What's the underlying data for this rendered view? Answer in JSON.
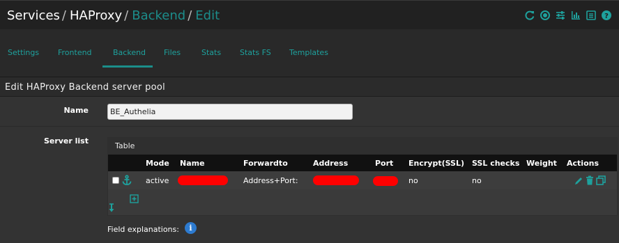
{
  "breadcrumb": {
    "items": [
      "Services",
      "HAProxy",
      "Backend",
      "Edit"
    ],
    "separator": "/"
  },
  "header_icons": [
    "reload-icon",
    "record-icon",
    "sliders-icon",
    "chart-icon",
    "list-icon",
    "help-icon"
  ],
  "tabs": [
    {
      "label": "Settings"
    },
    {
      "label": "Frontend"
    },
    {
      "label": "Backend"
    },
    {
      "label": "Files"
    },
    {
      "label": "Stats"
    },
    {
      "label": "Stats FS"
    },
    {
      "label": "Templates"
    }
  ],
  "active_tab": "Backend",
  "panel": {
    "title": "Edit HAProxy Backend server pool"
  },
  "form": {
    "name_label": "Name",
    "name_value": "BE_Authelia",
    "server_list_label": "Server list"
  },
  "server_table": {
    "caption": "Table",
    "columns": [
      "Mode",
      "Name",
      "Forwardto",
      "Address",
      "Port",
      "Encrypt(SSL)",
      "SSL checks",
      "Weight",
      "Actions"
    ],
    "rows": [
      {
        "mode": "active",
        "name": "",
        "forwardto": "Address+Port:",
        "address": "",
        "port": "",
        "encrypt": "no",
        "ssl_checks": "no",
        "weight": ""
      }
    ]
  },
  "field_explanations_label": "Field explanations:",
  "colors": {
    "accent": "#1ea19d",
    "background": "#333333",
    "header": "#212121",
    "redaction": "#ff0000",
    "info": "#2d7bd0"
  }
}
